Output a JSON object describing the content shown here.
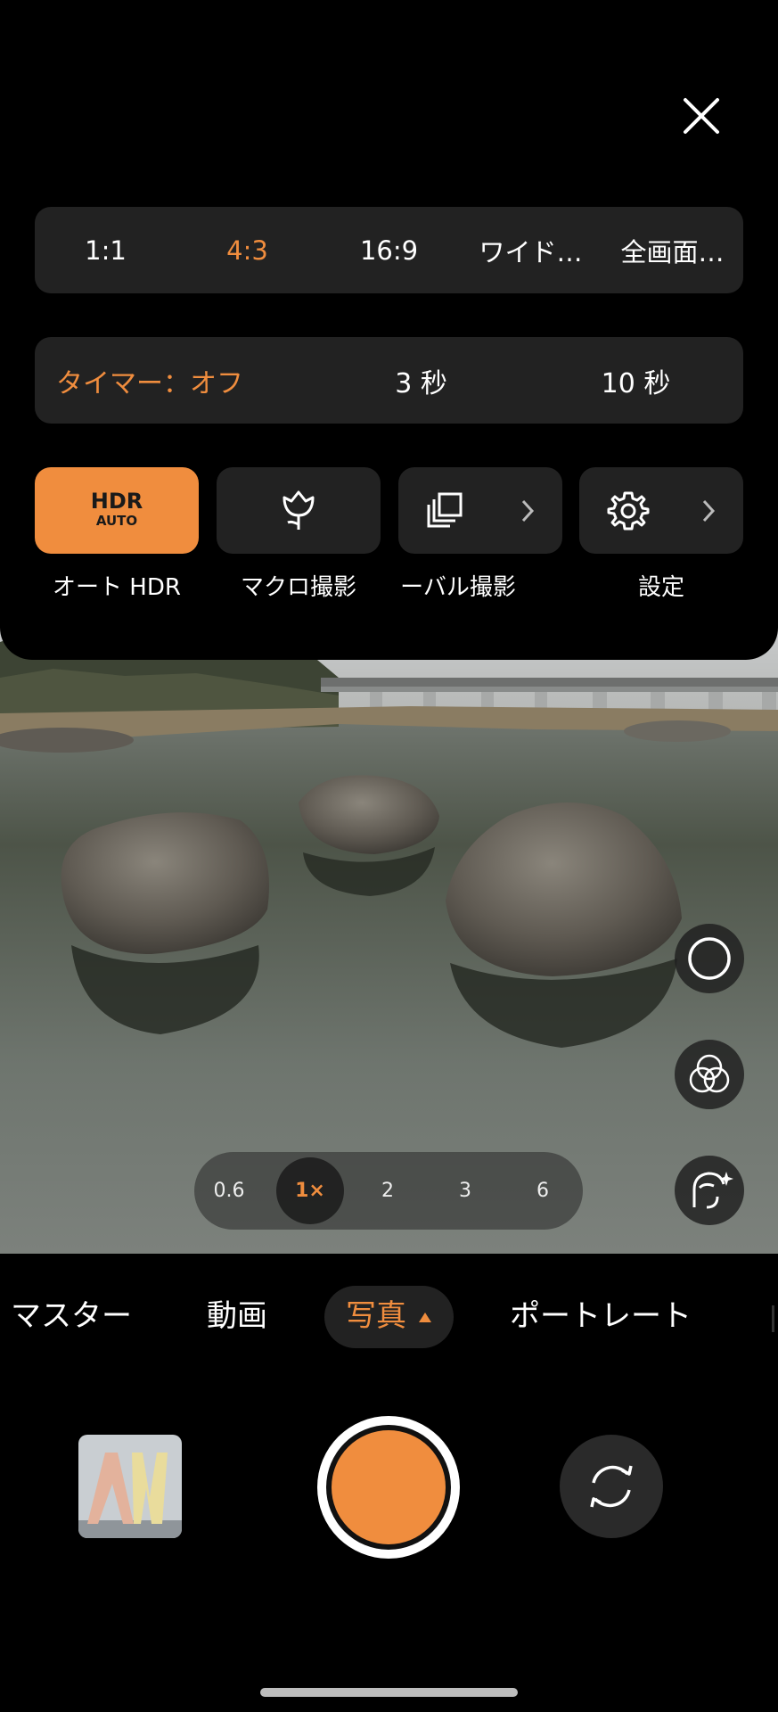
{
  "colors": {
    "accent": "#f08d3e",
    "status_dot": "#2ecc71"
  },
  "aspect_ratio": {
    "options": [
      "1:1",
      "4:3",
      "16:9",
      "ワイド…",
      "全画面…"
    ],
    "selected": "4:3"
  },
  "timer": {
    "options": [
      "タイマー：オフ",
      "3 秒",
      "10 秒"
    ],
    "selected": "タイマー：オフ"
  },
  "quick_settings": [
    {
      "label": "オート HDR",
      "icon": "hdr-auto-icon",
      "icon_text_main": "HDR",
      "icon_text_sub": "AUTO",
      "active": true
    },
    {
      "label": "マクロ撮影",
      "icon": "macro-flower-icon",
      "active": false
    },
    {
      "label": "ーバル撮影",
      "icon": "interval-stack-icon",
      "active": false
    },
    {
      "label": "設定",
      "icon": "gear-icon",
      "active": false
    }
  ],
  "zoom": {
    "levels": [
      "0.6",
      "1×",
      "2",
      "3",
      "6"
    ],
    "selected": "1×"
  },
  "modes": {
    "items": [
      "マスター",
      "動画",
      "写真",
      "ポートレート"
    ],
    "selected": "写真"
  },
  "side_controls": [
    "shutter-style-icon",
    "color-filter-icon",
    "beauty-face-icon"
  ]
}
